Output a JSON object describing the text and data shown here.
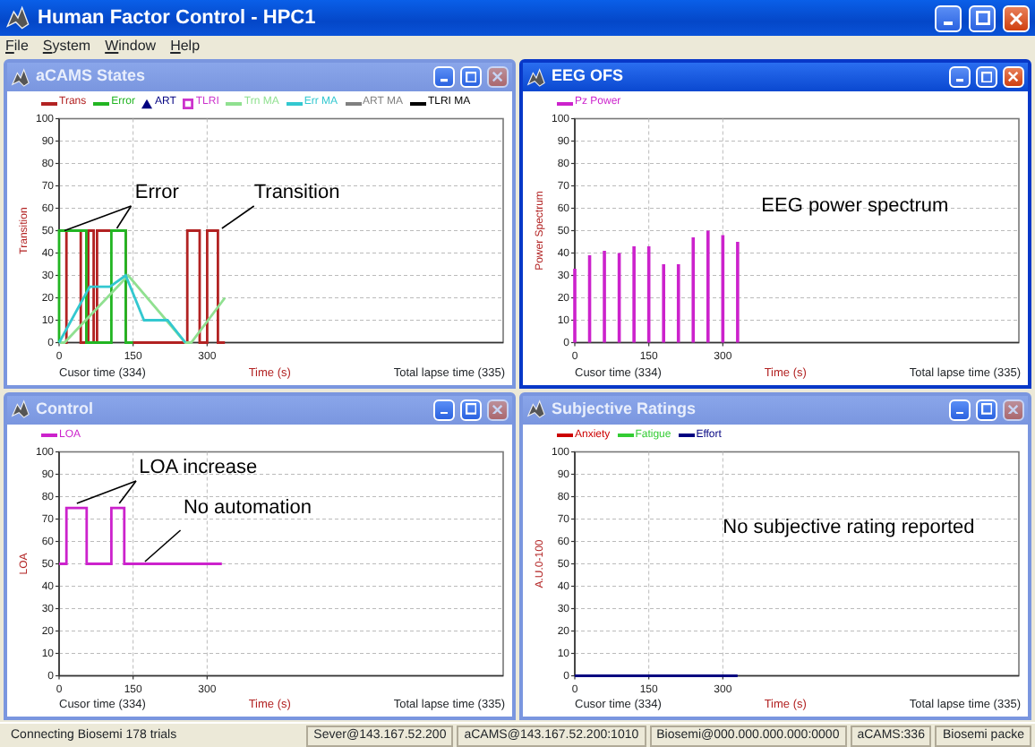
{
  "window": {
    "title": "Human Factor Control - HPC1"
  },
  "menu": [
    "File",
    "System",
    "Window",
    "Help"
  ],
  "panels": [
    {
      "title": "aCAMS States",
      "active": false,
      "cursor_time": "Cusor time (334)",
      "total_time": "Total lapse time (335)",
      "chart_data": {
        "type": "line",
        "grid": true,
        "legend": "top",
        "xlabel": "Time (s)",
        "ylabel": "Transition",
        "xlim": [
          0,
          900
        ],
        "ylim": [
          0,
          100
        ],
        "xticks": [
          0,
          150,
          300
        ],
        "yticks": [
          0,
          10,
          20,
          30,
          40,
          50,
          60,
          70,
          80,
          90,
          100
        ],
        "series": [
          {
            "name": "Trans",
            "color": "#b22222",
            "marker": "none",
            "x": [
              0,
              15,
              15,
              44,
              44,
              59,
              59,
              70,
              70,
              77,
              77,
              135,
              135,
              260,
              260,
              285,
              285,
              300,
              300,
              322,
              322,
              336
            ],
            "values": [
              0,
              0,
              50,
              50,
              0,
              0,
              50,
              50,
              0,
              0,
              50,
              50,
              0,
              0,
              50,
              50,
              0,
              0,
              50,
              50,
              0,
              0
            ]
          },
          {
            "name": "Error",
            "color": "#22b522",
            "marker": "none",
            "x": [
              0,
              0,
              55,
              55,
              106,
              106,
              135,
              135,
              150
            ],
            "values": [
              0,
              50,
              50,
              0,
              0,
              50,
              50,
              0,
              0
            ]
          },
          {
            "name": "ART",
            "color": "#000080",
            "marker": "triangle"
          },
          {
            "name": "TLRI",
            "color": "#cc33cc",
            "marker": "square"
          },
          {
            "name": "Trn MA",
            "color": "#90e090",
            "marker": "none",
            "x": [
              0,
              11,
              140,
              256,
              268,
              336
            ],
            "values": [
              0,
              0,
              30,
              0,
              0,
              20
            ]
          },
          {
            "name": "Err MA",
            "color": "#33c8d0",
            "marker": "none",
            "x": [
              0,
              62,
              103,
              135,
              172,
              220,
              256
            ],
            "values": [
              0,
              25,
              25,
              30,
              10,
              10,
              0
            ]
          },
          {
            "name": "ART MA",
            "color": "#808080",
            "marker": "none"
          },
          {
            "name": "TLRI MA",
            "color": "#000000",
            "marker": "none"
          }
        ],
        "annotations": [
          "Error",
          "Transition"
        ]
      }
    },
    {
      "title": "EEG OFS",
      "active": true,
      "cursor_time": "Cusor time (334)",
      "total_time": "Total lapse time (335)",
      "chart_data": {
        "type": "bar",
        "grid": true,
        "legend": "top",
        "xlabel": "Time (s)",
        "ylabel": "Power Spectrum",
        "xlim": [
          0,
          900
        ],
        "ylim": [
          0,
          100
        ],
        "xticks": [
          0,
          150,
          300
        ],
        "yticks": [
          0,
          10,
          20,
          30,
          40,
          50,
          60,
          70,
          80,
          90,
          100
        ],
        "x": [
          0,
          30,
          60,
          90,
          120,
          150,
          180,
          210,
          240,
          270,
          300,
          330
        ],
        "series": [
          {
            "name": "Pz Power",
            "color": "#cc22cc",
            "values": [
              33,
              39,
              41,
              40,
              43,
              43,
              35,
              35,
              47,
              50,
              48,
              45
            ]
          }
        ],
        "annotations": [
          "EEG power spectrum"
        ]
      }
    },
    {
      "title": "Control",
      "active": false,
      "cursor_time": "Cusor time (334)",
      "total_time": "Total lapse time (335)",
      "chart_data": {
        "type": "line",
        "grid": true,
        "legend": "top",
        "xlabel": "Time (s)",
        "ylabel": "LOA",
        "xlim": [
          0,
          900
        ],
        "ylim": [
          0,
          100
        ],
        "xticks": [
          0,
          150,
          300
        ],
        "yticks": [
          0,
          10,
          20,
          30,
          40,
          50,
          60,
          70,
          80,
          90,
          100
        ],
        "series": [
          {
            "name": "LOA",
            "color": "#cc22cc",
            "marker": "none",
            "x": [
              0,
              15,
              15,
              56,
              56,
              106,
              106,
              132,
              132,
              330
            ],
            "values": [
              50,
              50,
              75,
              75,
              50,
              50,
              75,
              75,
              50,
              50
            ]
          }
        ],
        "annotations": [
          "LOA increase",
          "No automation"
        ]
      }
    },
    {
      "title": "Subjective Ratings",
      "active": false,
      "cursor_time": "Cusor time (334)",
      "total_time": "Total lapse time (335)",
      "chart_data": {
        "type": "line",
        "grid": true,
        "legend": "top",
        "xlabel": "Time (s)",
        "ylabel": "A.U.0-100",
        "xlim": [
          0,
          900
        ],
        "ylim": [
          0,
          100
        ],
        "xticks": [
          0,
          150,
          300
        ],
        "yticks": [
          0,
          10,
          20,
          30,
          40,
          50,
          60,
          70,
          80,
          90,
          100
        ],
        "series": [
          {
            "name": "Anxiety",
            "color": "#cc0000",
            "marker": "none"
          },
          {
            "name": "Fatigue",
            "color": "#33cc33",
            "marker": "none"
          },
          {
            "name": "Effort",
            "color": "#000080",
            "marker": "none",
            "x": [
              0,
              330
            ],
            "values": [
              0,
              0
            ]
          }
        ],
        "annotations": [
          "No subjective rating reported"
        ]
      }
    }
  ],
  "status_bar": [
    "Connecting Biosemi 178 trials",
    "Sever@143.167.52.200",
    "aCAMS@143.167.52.200:1010",
    "Biosemi@000.000.000.000:0000",
    "aCAMS:336",
    "Biosemi packe"
  ]
}
